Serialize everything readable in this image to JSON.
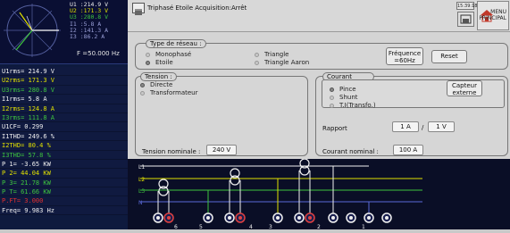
{
  "header": {
    "title": "Triphasé Etoile Acquisition:Arrêt",
    "clock": "15:39:18",
    "menu_line1": "MENU",
    "menu_line2": "PRINCIPAL"
  },
  "scope": {
    "u1": "U1 :214.9 V",
    "u2": "U2 :171.3 V",
    "u3": "U3 :280.8 V",
    "i1": "I1 :5.8 A",
    "i2": "I2 :141.3 A",
    "i3": "I3 :86.2 A",
    "freq": "F =50.000 Hz"
  },
  "measurements": [
    {
      "text": "U1rms=  214.9  V",
      "color": "#f0f0f0",
      "bg": "#101a40"
    },
    {
      "text": "U2rms=  171.3  V",
      "color": "#e0e000",
      "bg": "#101a40"
    },
    {
      "text": "U3rms=  280.8  V",
      "color": "#3ec43e",
      "bg": "#101a40"
    },
    {
      "text": "I1rms=  5.8  A",
      "color": "#f0f0f0",
      "bg": "#101a40"
    },
    {
      "text": "I2rms=  124.8  A",
      "color": "#e0e000",
      "bg": "#101a40"
    },
    {
      "text": "I3rms=  111.8  A",
      "color": "#3ec43e",
      "bg": "#101a40"
    },
    {
      "text": "U1CF=  0.299",
      "color": "#f0f0f0",
      "bg": "#101a40"
    },
    {
      "text": "I1THD=  249.6  %",
      "color": "#f0f0f0",
      "bg": "#101a40"
    },
    {
      "text": "I2THD=  80.4  %",
      "color": "#e0e000",
      "bg": "#101a40"
    },
    {
      "text": "I3THD=  57.8  %",
      "color": "#3ec43e",
      "bg": "#101a40"
    },
    {
      "text": "P 1=  -3.65  KW",
      "color": "#f0f0f0",
      "bg": "#101a40"
    },
    {
      "text": "P 2=  44.04  KW",
      "color": "#e0e000",
      "bg": "#101a40"
    },
    {
      "text": "P 3=  21.78  KW",
      "color": "#3ec43e",
      "bg": "#101a40"
    },
    {
      "text": "P T=  61.66  KW",
      "color": "#3ec43e",
      "bg": "#101a40"
    },
    {
      "text": "P.FT=  3.000",
      "color": "#e03030",
      "bg": "#101a40"
    },
    {
      "text": "Freq=  9.983  Hz",
      "color": "#f0f0f0",
      "bg": "#101a40"
    }
  ],
  "network": {
    "legend": "Type de réseau :",
    "options": [
      "Monophasé",
      "Etoile",
      "Triangle",
      "Triangle Aaron"
    ],
    "selected": "Etoile",
    "freq_label": "Fréquence",
    "freq_value": "=60Hz",
    "reset": "Reset"
  },
  "tension": {
    "legend": "Tension :",
    "options": [
      "Directe",
      "Transformateur"
    ],
    "selected": "Directe",
    "nominal_label": "Tension nominale :",
    "nominal_value": "240 V"
  },
  "courant": {
    "legend": "Courant",
    "options": [
      "Pince",
      "Shunt",
      "T.I(Transfo.)"
    ],
    "selected": "Pince",
    "capteur_line1": "Capteur",
    "capteur_line2": "externe",
    "rapport_label": "Rapport",
    "rapport_a": "1 A",
    "rapport_sep": "/",
    "rapport_b": "1 V",
    "nominal_label": "Courant nominal :",
    "nominal_value": "100 A"
  },
  "wiring": {
    "lines": [
      "L1",
      "L2",
      "L3",
      "N"
    ],
    "terminal_numbers": [
      "6",
      "5",
      "4",
      "3",
      "2",
      "1"
    ]
  }
}
